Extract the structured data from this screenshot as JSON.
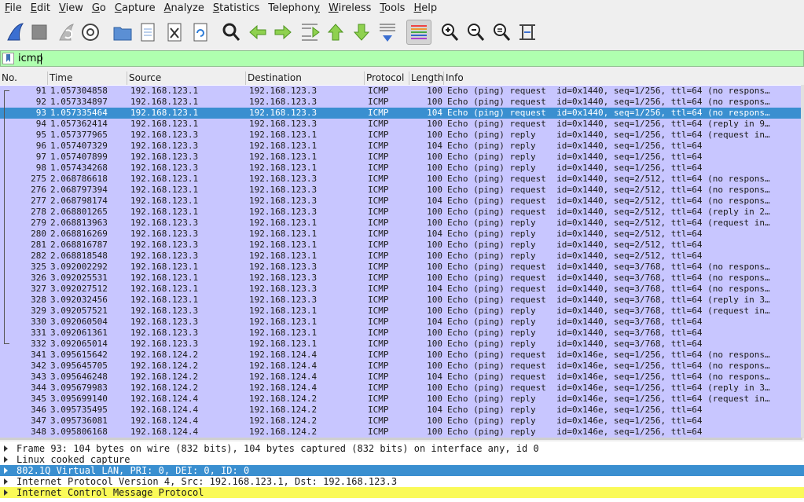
{
  "menu": [
    "File",
    "Edit",
    "View",
    "Go",
    "Capture",
    "Analyze",
    "Statistics",
    "Telephony",
    "Wireless",
    "Tools",
    "Help"
  ],
  "menu_mnemonic": [
    "F",
    "E",
    "V",
    "G",
    "C",
    "A",
    "S",
    "y",
    "W",
    "T",
    "H"
  ],
  "toolbar": {
    "icons": [
      "shark-fin-start-icon",
      "stop-capture-icon",
      "restart-capture-icon",
      "capture-options-gear-icon",
      "open-folder-icon",
      "save-file-icon",
      "close-file-icon",
      "reload-icon",
      "find-packet-icon",
      "go-back-icon",
      "go-forward-icon",
      "go-to-packet-icon",
      "go-first-icon",
      "go-last-icon",
      "autoscroll-icon",
      "colorize-icon",
      "zoom-in-icon",
      "zoom-out-icon",
      "zoom-normal-icon",
      "resize-columns-icon"
    ]
  },
  "filter": {
    "value": "icmp"
  },
  "columns": [
    "No.",
    "Time",
    "Source",
    "Destination",
    "Protocol",
    "Length",
    "Info"
  ],
  "packets": [
    {
      "no": "91",
      "time": "1.057304858",
      "src": "192.168.123.1",
      "dst": "192.168.123.3",
      "proto": "ICMP",
      "len": "100",
      "info": "Echo (ping) request  id=0x1440, seq=1/256, ttl=64 (no respons…"
    },
    {
      "no": "92",
      "time": "1.057334897",
      "src": "192.168.123.1",
      "dst": "192.168.123.3",
      "proto": "ICMP",
      "len": "100",
      "info": "Echo (ping) request  id=0x1440, seq=1/256, ttl=64 (no respons…"
    },
    {
      "no": "93",
      "time": "1.057335464",
      "src": "192.168.123.1",
      "dst": "192.168.123.3",
      "proto": "ICMP",
      "len": "104",
      "info": "Echo (ping) request  id=0x1440, seq=1/256, ttl=64 (no respons…",
      "selected": true
    },
    {
      "no": "94",
      "time": "1.057362414",
      "src": "192.168.123.1",
      "dst": "192.168.123.3",
      "proto": "ICMP",
      "len": "100",
      "info": "Echo (ping) request  id=0x1440, seq=1/256, ttl=64 (reply in 9…"
    },
    {
      "no": "95",
      "time": "1.057377965",
      "src": "192.168.123.3",
      "dst": "192.168.123.1",
      "proto": "ICMP",
      "len": "100",
      "info": "Echo (ping) reply    id=0x1440, seq=1/256, ttl=64 (request in…"
    },
    {
      "no": "96",
      "time": "1.057407329",
      "src": "192.168.123.3",
      "dst": "192.168.123.1",
      "proto": "ICMP",
      "len": "104",
      "info": "Echo (ping) reply    id=0x1440, seq=1/256, ttl=64"
    },
    {
      "no": "97",
      "time": "1.057407899",
      "src": "192.168.123.3",
      "dst": "192.168.123.1",
      "proto": "ICMP",
      "len": "100",
      "info": "Echo (ping) reply    id=0x1440, seq=1/256, ttl=64"
    },
    {
      "no": "98",
      "time": "1.057434268",
      "src": "192.168.123.3",
      "dst": "192.168.123.1",
      "proto": "ICMP",
      "len": "100",
      "info": "Echo (ping) reply    id=0x1440, seq=1/256, ttl=64"
    },
    {
      "no": "275",
      "time": "2.068786618",
      "src": "192.168.123.1",
      "dst": "192.168.123.3",
      "proto": "ICMP",
      "len": "100",
      "info": "Echo (ping) request  id=0x1440, seq=2/512, ttl=64 (no respons…"
    },
    {
      "no": "276",
      "time": "2.068797394",
      "src": "192.168.123.1",
      "dst": "192.168.123.3",
      "proto": "ICMP",
      "len": "100",
      "info": "Echo (ping) request  id=0x1440, seq=2/512, ttl=64 (no respons…"
    },
    {
      "no": "277",
      "time": "2.068798174",
      "src": "192.168.123.1",
      "dst": "192.168.123.3",
      "proto": "ICMP",
      "len": "104",
      "info": "Echo (ping) request  id=0x1440, seq=2/512, ttl=64 (no respons…"
    },
    {
      "no": "278",
      "time": "2.068801265",
      "src": "192.168.123.1",
      "dst": "192.168.123.3",
      "proto": "ICMP",
      "len": "100",
      "info": "Echo (ping) request  id=0x1440, seq=2/512, ttl=64 (reply in 2…"
    },
    {
      "no": "279",
      "time": "2.068813963",
      "src": "192.168.123.3",
      "dst": "192.168.123.1",
      "proto": "ICMP",
      "len": "100",
      "info": "Echo (ping) reply    id=0x1440, seq=2/512, ttl=64 (request in…"
    },
    {
      "no": "280",
      "time": "2.068816269",
      "src": "192.168.123.3",
      "dst": "192.168.123.1",
      "proto": "ICMP",
      "len": "104",
      "info": "Echo (ping) reply    id=0x1440, seq=2/512, ttl=64"
    },
    {
      "no": "281",
      "time": "2.068816787",
      "src": "192.168.123.3",
      "dst": "192.168.123.1",
      "proto": "ICMP",
      "len": "100",
      "info": "Echo (ping) reply    id=0x1440, seq=2/512, ttl=64"
    },
    {
      "no": "282",
      "time": "2.068818548",
      "src": "192.168.123.3",
      "dst": "192.168.123.1",
      "proto": "ICMP",
      "len": "100",
      "info": "Echo (ping) reply    id=0x1440, seq=2/512, ttl=64"
    },
    {
      "no": "325",
      "time": "3.092002292",
      "src": "192.168.123.1",
      "dst": "192.168.123.3",
      "proto": "ICMP",
      "len": "100",
      "info": "Echo (ping) request  id=0x1440, seq=3/768, ttl=64 (no respons…"
    },
    {
      "no": "326",
      "time": "3.092025531",
      "src": "192.168.123.1",
      "dst": "192.168.123.3",
      "proto": "ICMP",
      "len": "100",
      "info": "Echo (ping) request  id=0x1440, seq=3/768, ttl=64 (no respons…"
    },
    {
      "no": "327",
      "time": "3.092027512",
      "src": "192.168.123.1",
      "dst": "192.168.123.3",
      "proto": "ICMP",
      "len": "104",
      "info": "Echo (ping) request  id=0x1440, seq=3/768, ttl=64 (no respons…"
    },
    {
      "no": "328",
      "time": "3.092032456",
      "src": "192.168.123.1",
      "dst": "192.168.123.3",
      "proto": "ICMP",
      "len": "100",
      "info": "Echo (ping) request  id=0x1440, seq=3/768, ttl=64 (reply in 3…"
    },
    {
      "no": "329",
      "time": "3.092057521",
      "src": "192.168.123.3",
      "dst": "192.168.123.1",
      "proto": "ICMP",
      "len": "100",
      "info": "Echo (ping) reply    id=0x1440, seq=3/768, ttl=64 (request in…"
    },
    {
      "no": "330",
      "time": "3.092060504",
      "src": "192.168.123.3",
      "dst": "192.168.123.1",
      "proto": "ICMP",
      "len": "104",
      "info": "Echo (ping) reply    id=0x1440, seq=3/768, ttl=64"
    },
    {
      "no": "331",
      "time": "3.092061361",
      "src": "192.168.123.3",
      "dst": "192.168.123.1",
      "proto": "ICMP",
      "len": "100",
      "info": "Echo (ping) reply    id=0x1440, seq=3/768, ttl=64"
    },
    {
      "no": "332",
      "time": "3.092065014",
      "src": "192.168.123.3",
      "dst": "192.168.123.1",
      "proto": "ICMP",
      "len": "100",
      "info": "Echo (ping) reply    id=0x1440, seq=3/768, ttl=64"
    },
    {
      "no": "341",
      "time": "3.095615642",
      "src": "192.168.124.2",
      "dst": "192.168.124.4",
      "proto": "ICMP",
      "len": "100",
      "info": "Echo (ping) request  id=0x146e, seq=1/256, ttl=64 (no respons…"
    },
    {
      "no": "342",
      "time": "3.095645705",
      "src": "192.168.124.2",
      "dst": "192.168.124.4",
      "proto": "ICMP",
      "len": "100",
      "info": "Echo (ping) request  id=0x146e, seq=1/256, ttl=64 (no respons…"
    },
    {
      "no": "343",
      "time": "3.095646248",
      "src": "192.168.124.2",
      "dst": "192.168.124.4",
      "proto": "ICMP",
      "len": "104",
      "info": "Echo (ping) request  id=0x146e, seq=1/256, ttl=64 (no respons…"
    },
    {
      "no": "344",
      "time": "3.095679983",
      "src": "192.168.124.2",
      "dst": "192.168.124.4",
      "proto": "ICMP",
      "len": "100",
      "info": "Echo (ping) request  id=0x146e, seq=1/256, ttl=64 (reply in 3…"
    },
    {
      "no": "345",
      "time": "3.095699140",
      "src": "192.168.124.4",
      "dst": "192.168.124.2",
      "proto": "ICMP",
      "len": "100",
      "info": "Echo (ping) reply    id=0x146e, seq=1/256, ttl=64 (request in…"
    },
    {
      "no": "346",
      "time": "3.095735495",
      "src": "192.168.124.4",
      "dst": "192.168.124.2",
      "proto": "ICMP",
      "len": "104",
      "info": "Echo (ping) reply    id=0x146e, seq=1/256, ttl=64"
    },
    {
      "no": "347",
      "time": "3.095736081",
      "src": "192.168.124.4",
      "dst": "192.168.124.2",
      "proto": "ICMP",
      "len": "100",
      "info": "Echo (ping) reply    id=0x146e, seq=1/256, ttl=64"
    },
    {
      "no": "348",
      "time": "3.095806168",
      "src": "192.168.124.4",
      "dst": "192.168.124.2",
      "proto": "ICMP",
      "len": "100",
      "info": "Echo (ping) reply    id=0x146e, seq=1/256, ttl=64"
    }
  ],
  "details": [
    {
      "text": "Frame 93: 104 bytes on wire (832 bits), 104 bytes captured (832 bits) on interface any, id 0"
    },
    {
      "text": "Linux cooked capture"
    },
    {
      "text": "802.1Q Virtual LAN, PRI: 0, DEI: 0, ID: 0",
      "selected": true
    },
    {
      "text": "Internet Protocol Version 4, Src: 192.168.123.1, Dst: 192.168.123.3"
    },
    {
      "text": "Internet Control Message Protocol",
      "warn": true
    }
  ],
  "colors": {
    "row_bg": "#c8c6ff",
    "selected_bg": "#3a8fd0",
    "filter_bg": "#afffaf",
    "expert_yellow": "#fafa58"
  }
}
